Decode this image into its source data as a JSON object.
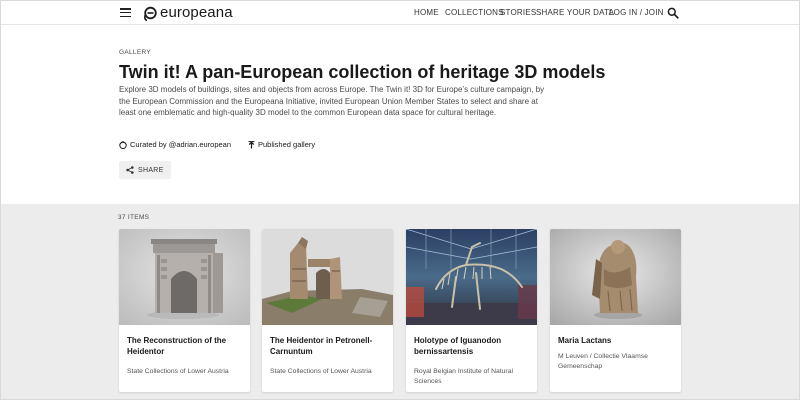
{
  "header": {
    "logo_text": "europeana",
    "nav": [
      "HOME",
      "COLLECTIONS",
      "STORIES",
      "SHARE YOUR DATA",
      "LOG IN / JOIN"
    ],
    "icons": [
      "hamburger-menu-icon",
      "search-icon"
    ]
  },
  "gallery": {
    "eyebrow": "GALLERY",
    "title": "Twin it! A pan-European collection of heritage 3D models",
    "description": "Explore 3D models of buildings, sites and objects from across Europe. The Twin it! 3D for Europe’s culture campaign, by the European Commission and the Europeana Initiative, invited European Union Member States to select and share at least one emblematic and high-quality 3D model to the common European data space for cultural heritage.",
    "curated_by": "Curated by @adrian.european",
    "status": "Published gallery",
    "share_label": "SHARE"
  },
  "items": {
    "count_label": "37 ITEMS",
    "cards": [
      {
        "title": "The Reconstruction of the Heidentor",
        "subtitle": "State Collections of Lower Austria"
      },
      {
        "title": "The Heidentor in Petronell-Carnuntum",
        "subtitle": "State Collections of Lower Austria"
      },
      {
        "title": "Holotype of Iguanodon bernissartensis",
        "subtitle": "Royal Belgian Institute of Natural Sciences"
      },
      {
        "title": "Maria Lactans",
        "subtitle": "M Leuven / Collectie Vlaamse Gemeenschap"
      }
    ]
  },
  "colors": {
    "page_bg": "#ffffff",
    "items_bg": "#ececec",
    "text": "#1a1a1a",
    "share_bg": "#f0f0f0"
  }
}
